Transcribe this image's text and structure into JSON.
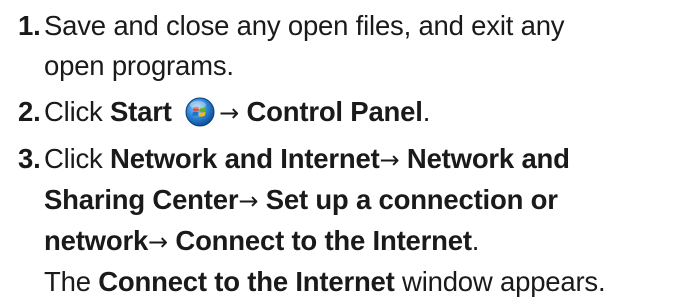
{
  "steps": [
    {
      "number": "1.",
      "line1": "Save and close any open files, and exit any",
      "line2": "open programs."
    },
    {
      "number": "2.",
      "pre": "Click ",
      "bold1": "Start",
      "icon": "windows-start-orb-icon",
      "arrow": "→",
      "bold2": "Control Panel",
      "post": "."
    },
    {
      "number": "3.",
      "pre": "Click ",
      "bold1": "Network and Internet",
      "arrow1": "→",
      "bold2": "Network and",
      "bold3": "Sharing Center",
      "arrow2": "→",
      "bold4": "Set up a connection or",
      "bold5": "network",
      "arrow3": "→",
      "bold6": "Connect to the Internet",
      "post": ".",
      "result_pre": "The ",
      "result_bold": "Connect to the Internet",
      "result_post": " window appears."
    }
  ],
  "colors": {
    "text": "#1a1a1a",
    "orb_blue": "#1f73c6",
    "orb_red": "#e8422b",
    "orb_green": "#5ab134",
    "orb_yellow": "#f6b90f"
  }
}
